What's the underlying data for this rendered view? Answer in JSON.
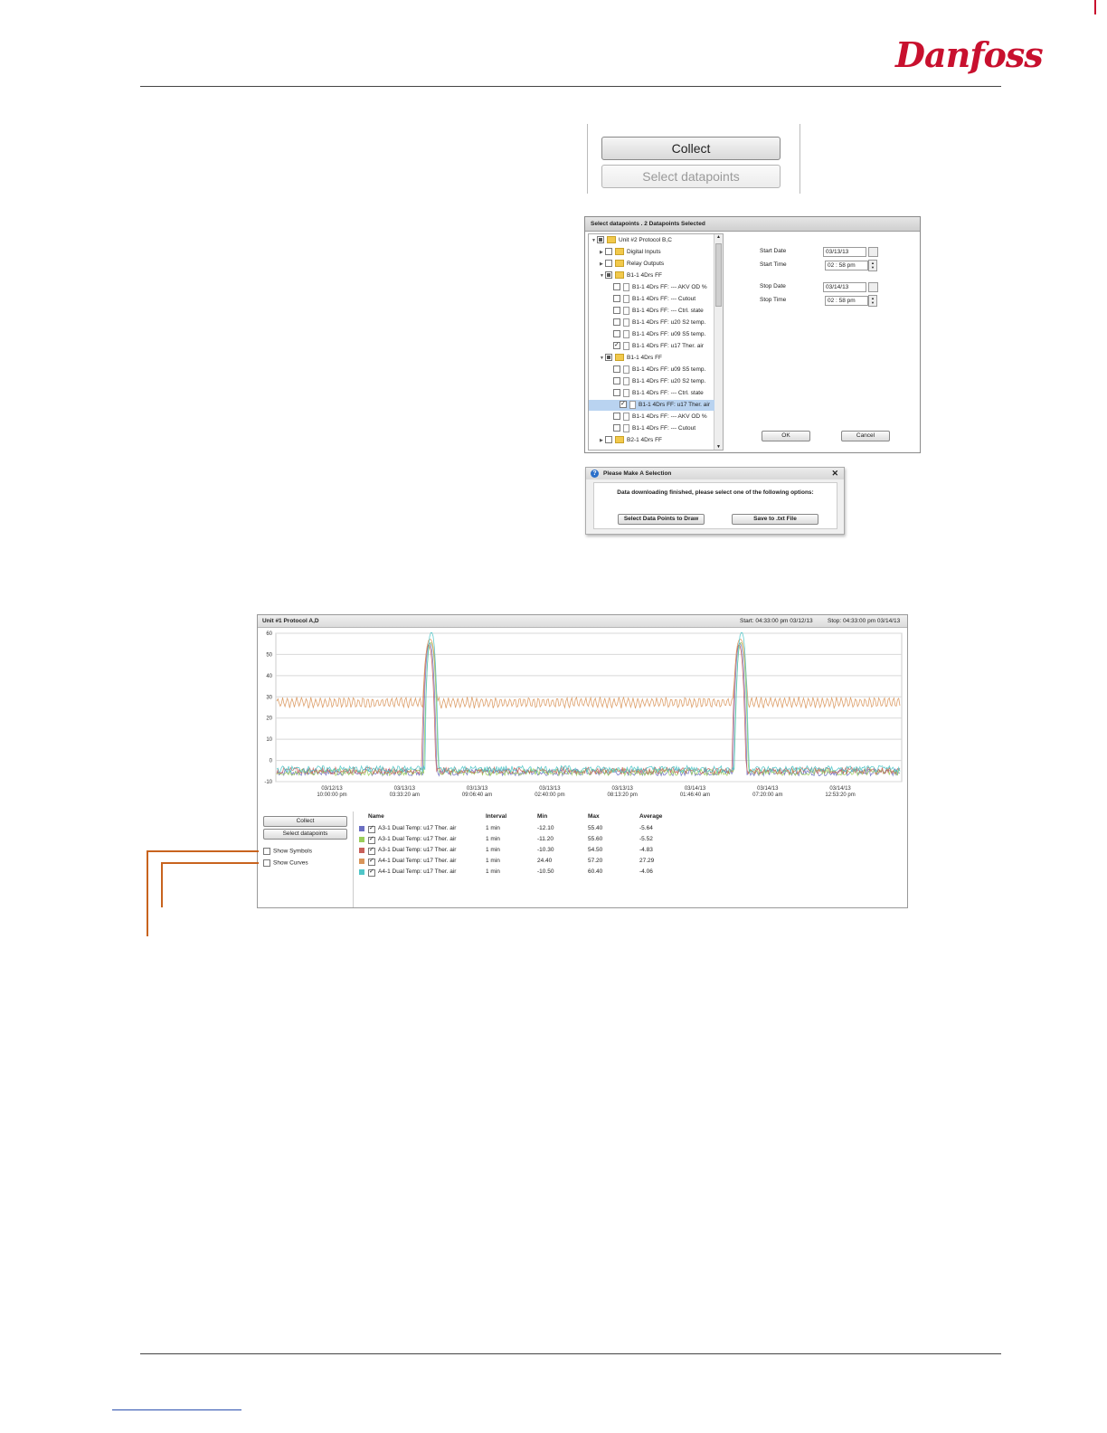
{
  "brand": {
    "logo_text": "Danfoss",
    "logo_color": "#c8102e"
  },
  "collect_panel": {
    "collect_label": "Collect",
    "select_label": "Select datapoints"
  },
  "select_dialog": {
    "title": "Select datapoints . 2 Datapoints Selected",
    "tree": [
      {
        "label": "Unit #2  Protocol B,C",
        "indent": 0,
        "expander": "▼",
        "check": "part",
        "icon": "folder"
      },
      {
        "label": "Digital Inputs",
        "indent": 1,
        "expander": "▶",
        "check": "off",
        "icon": "folder"
      },
      {
        "label": "Relay Outputs",
        "indent": 1,
        "expander": "▶",
        "check": "off",
        "icon": "folder"
      },
      {
        "label": "B1-1 4Drs FF",
        "indent": 1,
        "expander": "▼",
        "check": "part",
        "icon": "folder"
      },
      {
        "label": "B1-1 4Drs FF:   --- AKV OD %",
        "indent": 2,
        "expander": "",
        "check": "off",
        "icon": "doc"
      },
      {
        "label": "B1-1 4Drs FF:   --- Cutout",
        "indent": 2,
        "expander": "",
        "check": "off",
        "icon": "doc"
      },
      {
        "label": "B1-1 4Drs FF:   --- Ctrl. state",
        "indent": 2,
        "expander": "",
        "check": "off",
        "icon": "doc"
      },
      {
        "label": "B1-1 4Drs FF:   u20 S2 temp.",
        "indent": 2,
        "expander": "",
        "check": "off",
        "icon": "doc"
      },
      {
        "label": "B1-1 4Drs FF:   u09 S5 temp.",
        "indent": 2,
        "expander": "",
        "check": "off",
        "icon": "doc"
      },
      {
        "label": "B1-1 4Drs FF:   u17 Ther. air",
        "indent": 2,
        "expander": "",
        "check": "on",
        "icon": "doc"
      },
      {
        "label": "B1-1 4Drs FF",
        "indent": 1,
        "expander": "▼",
        "check": "part",
        "icon": "folder"
      },
      {
        "label": "B1-1 4Drs FF:   u09 S5 temp.",
        "indent": 2,
        "expander": "",
        "check": "off",
        "icon": "doc"
      },
      {
        "label": "B1-1 4Drs FF:   u20 S2 temp.",
        "indent": 2,
        "expander": "",
        "check": "off",
        "icon": "doc"
      },
      {
        "label": "B1-1 4Drs FF:   --- Ctrl. state",
        "indent": 2,
        "expander": "",
        "check": "off",
        "icon": "doc"
      },
      {
        "label": "B1-1 4Drs FF:   u17 Ther. air",
        "indent": 2,
        "expander": "",
        "check": "on",
        "icon": "doc",
        "selected": true
      },
      {
        "label": "B1-1 4Drs FF:   --- AKV OD %",
        "indent": 2,
        "expander": "",
        "check": "off",
        "icon": "doc"
      },
      {
        "label": "B1-1 4Drs FF:   --- Cutout",
        "indent": 2,
        "expander": "",
        "check": "off",
        "icon": "doc"
      },
      {
        "label": "B2-1 4Drs FF",
        "indent": 1,
        "expander": "▶",
        "check": "off",
        "icon": "folder"
      }
    ],
    "start_date_label": "Start Date",
    "start_date": "03/13/13",
    "start_time_label": "Start Time",
    "start_time": "02 : 58  pm",
    "stop_date_label": "Stop Date",
    "stop_date": "03/14/13",
    "stop_time_label": "Stop Time",
    "stop_time": "02 : 58  pm",
    "ok_label": "OK",
    "cancel_label": "Cancel"
  },
  "make_selection_dialog": {
    "title": "Please Make A Selection",
    "message": "Data downloading finished, please select one of the following options:",
    "btn_draw": "Select Data Points to Draw",
    "btn_save": "Save to .txt File"
  },
  "chart_window": {
    "title": "Unit #1   Protocol A,D",
    "start_text": "Start: 04:33:00 pm  03/12/13",
    "stop_text": "Stop: 04:33:00 pm  03/14/13",
    "collect_label": "Collect",
    "select_label": "Select datapoints",
    "show_symbols": "Show Symbols",
    "show_curves": "Show Curves",
    "legend_headers": [
      "Name",
      "Interval",
      "Min",
      "Max",
      "Average"
    ],
    "legend_rows": [
      {
        "color": "#6b6fc2",
        "name": "A3-1 Dual Temp:  u17 Ther. air",
        "interval": "1 min",
        "min": "-12.10",
        "max": "55.40",
        "avg": "-5.64"
      },
      {
        "color": "#9acd5a",
        "name": "A3-1 Dual Temp:  u17 Ther. air",
        "interval": "1 min",
        "min": "-11.20",
        "max": "55.60",
        "avg": "-5.52"
      },
      {
        "color": "#c8605a",
        "name": "A3-1 Dual Temp:  u17 Ther. air",
        "interval": "1 min",
        "min": "-10.30",
        "max": "54.50",
        "avg": "-4.83"
      },
      {
        "color": "#d9955a",
        "name": "A4-1 Dual Temp:  u17 Ther. air",
        "interval": "1 min",
        "min": "24.40",
        "max": "57.20",
        "avg": "27.29"
      },
      {
        "color": "#4fc6c8",
        "name": "A4-1 Dual Temp:  u17 Ther. air",
        "interval": "1 min",
        "min": "-10.50",
        "max": "60.40",
        "avg": "-4.06"
      }
    ]
  },
  "chart_data": {
    "type": "line",
    "title": "",
    "xlabel": "",
    "ylabel": "",
    "ylim": [
      -10,
      60
    ],
    "y_ticks": [
      -10,
      0,
      10,
      20,
      30,
      40,
      50,
      60
    ],
    "x_ticks": [
      [
        "03/12/13",
        "10:00:00 pm"
      ],
      [
        "03/13/13",
        "03:33:20 am"
      ],
      [
        "03/13/13",
        "09:06:40 am"
      ],
      [
        "03/13/13",
        "02:40:00 pm"
      ],
      [
        "03/13/13",
        "08:13:20 pm"
      ],
      [
        "03/14/13",
        "01:46:40 am"
      ],
      [
        "03/14/13",
        "07:20:00 am"
      ],
      [
        "03/14/13",
        "12:53:20 pm"
      ]
    ],
    "grid": true,
    "series": [
      {
        "name": "A3-1 Dual Temp:  u17 Ther. air",
        "color": "#6b6fc2",
        "baseline": -5.6,
        "peak": 55.4
      },
      {
        "name": "A3-1 Dual Temp:  u17 Ther. air",
        "color": "#9acd5a",
        "baseline": -5.5,
        "peak": 55.6
      },
      {
        "name": "A3-1 Dual Temp:  u17 Ther. air",
        "color": "#c8605a",
        "baseline": -4.8,
        "peak": 54.5
      },
      {
        "name": "A4-1 Dual Temp:  u17 Ther. air",
        "color": "#d9955a",
        "baseline": 27.3,
        "peak": 57.2
      },
      {
        "name": "A4-1 Dual Temp:  u17 Ther. air",
        "color": "#4fc6c8",
        "baseline": -4.1,
        "peak": 60.4
      }
    ],
    "defrost_peaks_at": [
      "03/13/13 ~06:00 am",
      "03/14/13 ~06:00 am"
    ]
  },
  "annotation_color": "#c8631e"
}
